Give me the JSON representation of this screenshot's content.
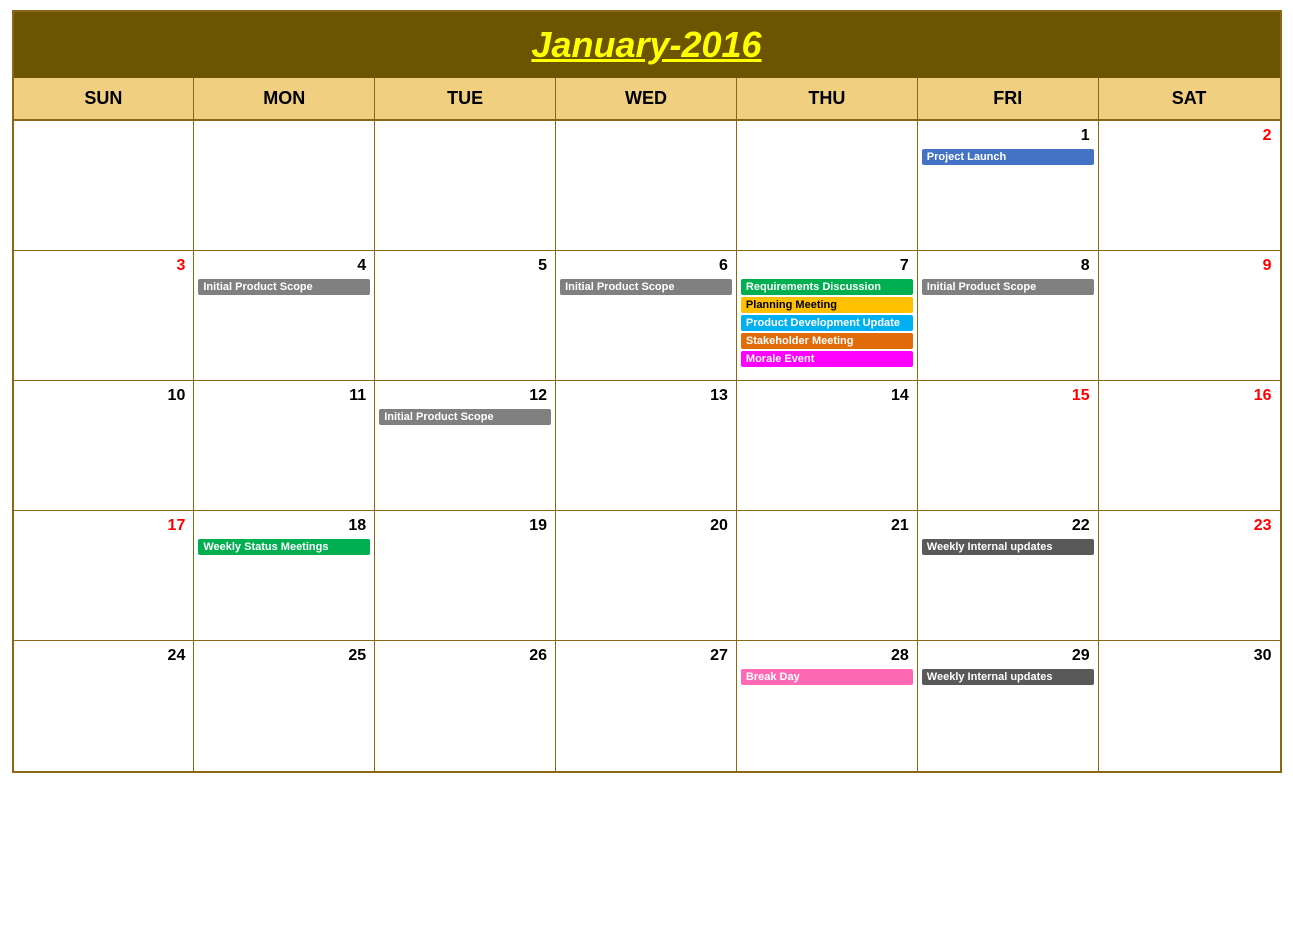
{
  "calendar": {
    "title": "January-2016",
    "days_of_week": [
      "SUN",
      "MON",
      "TUE",
      "WED",
      "THU",
      "FRI",
      "SAT"
    ],
    "weeks": [
      [
        {
          "day": "",
          "number_class": "",
          "events": []
        },
        {
          "day": "",
          "number_class": "",
          "events": []
        },
        {
          "day": "",
          "number_class": "",
          "events": []
        },
        {
          "day": "",
          "number_class": "",
          "events": []
        },
        {
          "day": "",
          "number_class": "",
          "events": []
        },
        {
          "day": "1",
          "number_class": "",
          "events": [
            {
              "label": "Project Launch",
              "color": "event-blue"
            }
          ]
        },
        {
          "day": "2",
          "number_class": "red",
          "events": []
        }
      ],
      [
        {
          "day": "3",
          "number_class": "red",
          "events": []
        },
        {
          "day": "4",
          "number_class": "",
          "events": [
            {
              "label": "Initial Product Scope",
              "color": "event-gray"
            }
          ]
        },
        {
          "day": "5",
          "number_class": "",
          "events": []
        },
        {
          "day": "6",
          "number_class": "",
          "events": [
            {
              "label": "Initial Product Scope",
              "color": "event-gray"
            }
          ]
        },
        {
          "day": "7",
          "number_class": "",
          "events": [
            {
              "label": "Requirements Discussion",
              "color": "event-green"
            },
            {
              "label": "Planning Meeting",
              "color": "event-yellow"
            },
            {
              "label": "Product Development Update",
              "color": "event-lightblue"
            },
            {
              "label": "Stakeholder Meeting",
              "color": "event-orange"
            },
            {
              "label": "Morale Event",
              "color": "event-magenta"
            }
          ]
        },
        {
          "day": "8",
          "number_class": "",
          "events": [
            {
              "label": "Initial Product Scope",
              "color": "event-gray"
            }
          ]
        },
        {
          "day": "9",
          "number_class": "red",
          "events": []
        }
      ],
      [
        {
          "day": "10",
          "number_class": "",
          "events": []
        },
        {
          "day": "11",
          "number_class": "",
          "events": []
        },
        {
          "day": "12",
          "number_class": "",
          "events": [
            {
              "label": "Initial Product Scope",
              "color": "event-gray"
            }
          ]
        },
        {
          "day": "13",
          "number_class": "",
          "events": []
        },
        {
          "day": "14",
          "number_class": "",
          "events": []
        },
        {
          "day": "15",
          "number_class": "red",
          "events": []
        },
        {
          "day": "16",
          "number_class": "red",
          "events": []
        }
      ],
      [
        {
          "day": "17",
          "number_class": "red",
          "events": []
        },
        {
          "day": "18",
          "number_class": "",
          "events": [
            {
              "label": "Weekly Status Meetings",
              "color": "event-green"
            }
          ]
        },
        {
          "day": "19",
          "number_class": "",
          "events": []
        },
        {
          "day": "20",
          "number_class": "",
          "events": []
        },
        {
          "day": "21",
          "number_class": "",
          "events": []
        },
        {
          "day": "22",
          "number_class": "",
          "events": [
            {
              "label": "Weekly Internal updates",
              "color": "event-darkgray"
            }
          ]
        },
        {
          "day": "23",
          "number_class": "red",
          "events": []
        }
      ],
      [
        {
          "day": "24",
          "number_class": "",
          "events": []
        },
        {
          "day": "25",
          "number_class": "",
          "events": []
        },
        {
          "day": "26",
          "number_class": "",
          "events": []
        },
        {
          "day": "27",
          "number_class": "",
          "events": []
        },
        {
          "day": "28",
          "number_class": "",
          "events": [
            {
              "label": "Break Day",
              "color": "event-pink"
            }
          ]
        },
        {
          "day": "29",
          "number_class": "",
          "events": [
            {
              "label": "Weekly Internal updates",
              "color": "event-darkgray"
            }
          ]
        },
        {
          "day": "30",
          "number_class": "",
          "events": []
        }
      ]
    ]
  }
}
